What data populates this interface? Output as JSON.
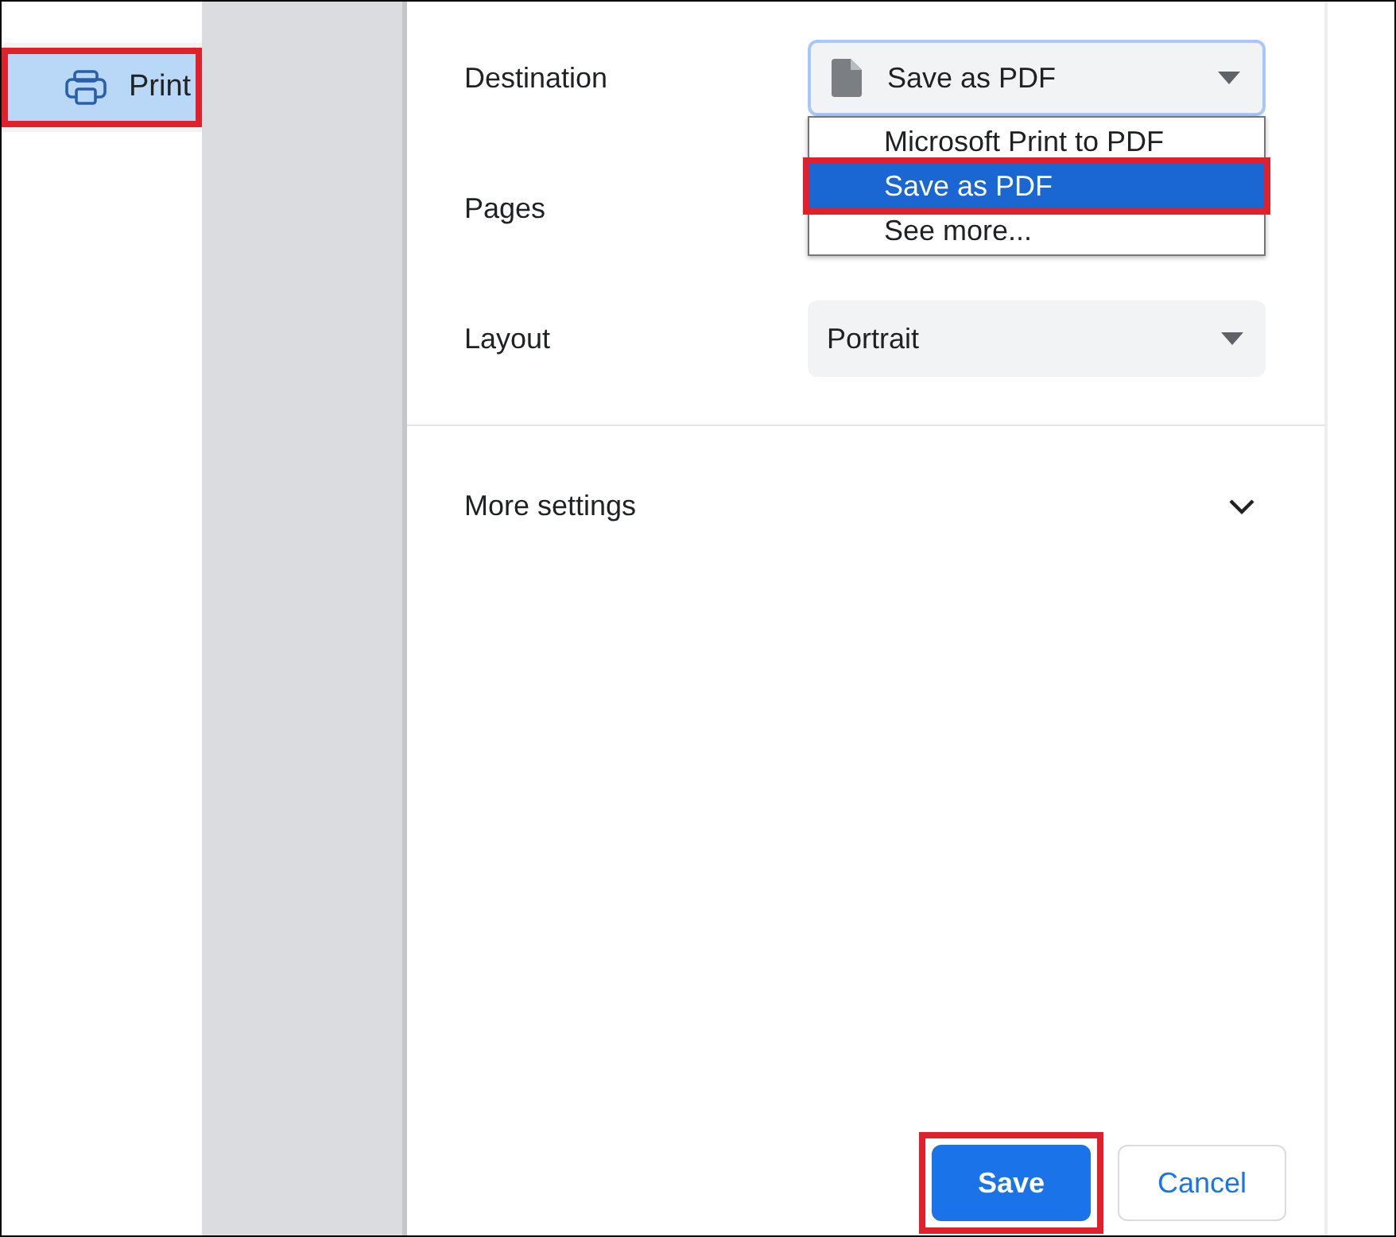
{
  "sidebar": {
    "items": [
      {
        "label": "Print",
        "highlighted": true
      }
    ]
  },
  "settings": [
    {
      "label": "Destination",
      "kind": "select",
      "value": "Save as PDF",
      "expanded": true,
      "options": [
        {
          "label": "Microsoft Print to PDF",
          "selected": false,
          "highlighted": false
        },
        {
          "label": "Save as PDF",
          "selected": true,
          "highlighted": true
        },
        {
          "label": "See more...",
          "selected": false,
          "highlighted": false
        }
      ]
    },
    {
      "label": "Pages",
      "kind": "blank"
    },
    {
      "label": "Layout",
      "kind": "select",
      "value": "Portrait",
      "expanded": false
    }
  ],
  "more_settings": {
    "label": "More settings",
    "expanded": false
  },
  "buttons": [
    {
      "label": "Save",
      "kind": "primary",
      "highlighted": true
    },
    {
      "label": "Cancel",
      "kind": "secondary",
      "highlighted": false
    }
  ]
}
